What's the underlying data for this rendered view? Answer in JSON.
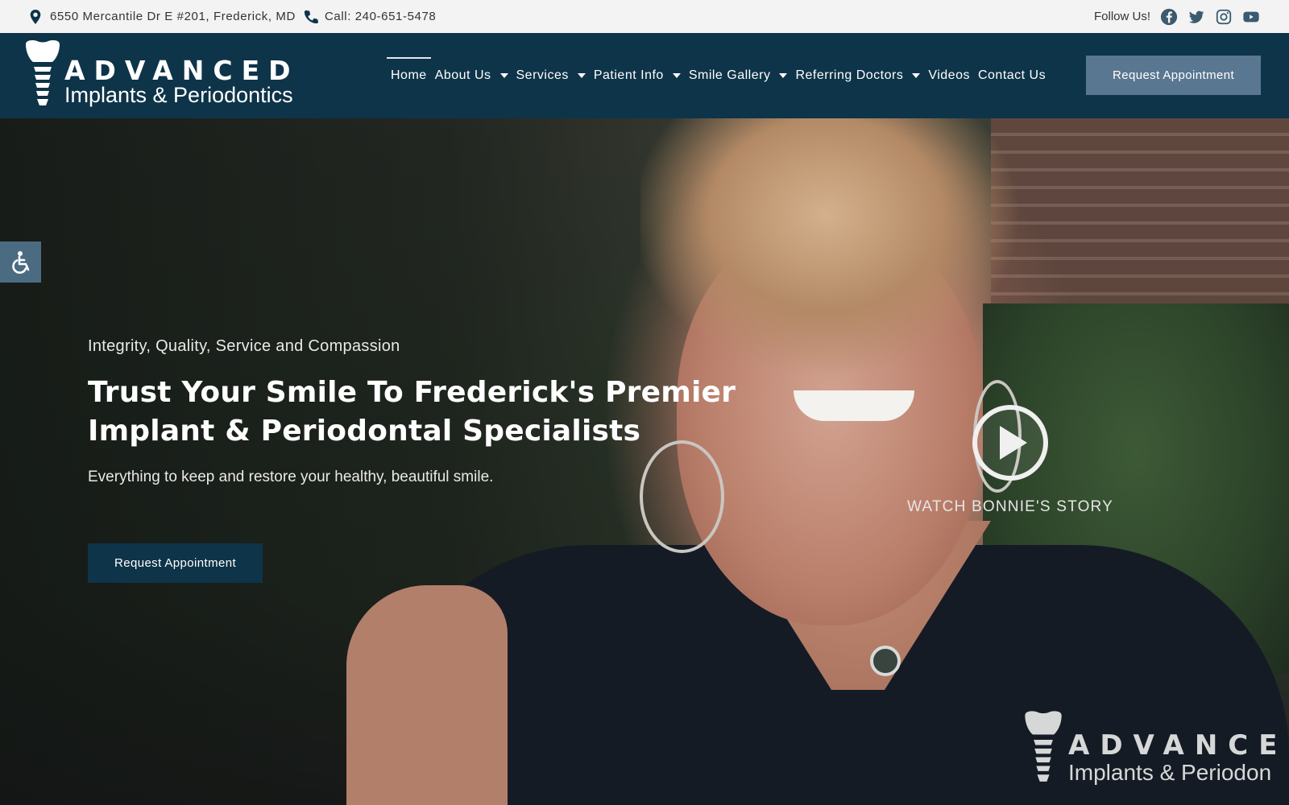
{
  "topbar": {
    "address": "6550 Mercantile Dr E #201, Frederick, MD",
    "phone": "Call: 240-651-5478",
    "follow_label": "Follow Us!",
    "social_icons": [
      "facebook-icon",
      "twitter-icon",
      "instagram-icon",
      "youtube-icon"
    ]
  },
  "logo": {
    "line1": "ADVANCED",
    "line2": "Implants & Periodontics"
  },
  "nav": {
    "items": [
      {
        "label": "Home",
        "active": true,
        "dropdown": false
      },
      {
        "label": "About Us",
        "dropdown": true
      },
      {
        "label": "Services",
        "dropdown": true
      },
      {
        "label": "Patient Info",
        "dropdown": true
      },
      {
        "label": "Smile Gallery",
        "dropdown": true
      },
      {
        "label": "Referring Doctors",
        "dropdown": true
      },
      {
        "label": "Videos",
        "dropdown": false
      },
      {
        "label": "Contact Us",
        "dropdown": false
      }
    ],
    "cta_label": "Request Appointment"
  },
  "hero": {
    "tagline": "Integrity, Quality, Service and Compassion",
    "headline_line1": "Trust Your Smile To Frederick's Premier",
    "headline_line2": "Implant & Periodontal Specialists",
    "subtext": "Everything to keep and restore your healthy, beautiful smile.",
    "cta_label": "Request Appointment",
    "video_label": "WATCH BONNIE'S STORY"
  },
  "watermark": {
    "line1": "ADVANCE",
    "line2": "Implants & Periodon"
  },
  "colors": {
    "header_bg": "#0e3449",
    "topbar_bg": "#f3f3f3",
    "header_cta_bg": "#5a7791",
    "accessibility_bg": "#4b6b82"
  }
}
